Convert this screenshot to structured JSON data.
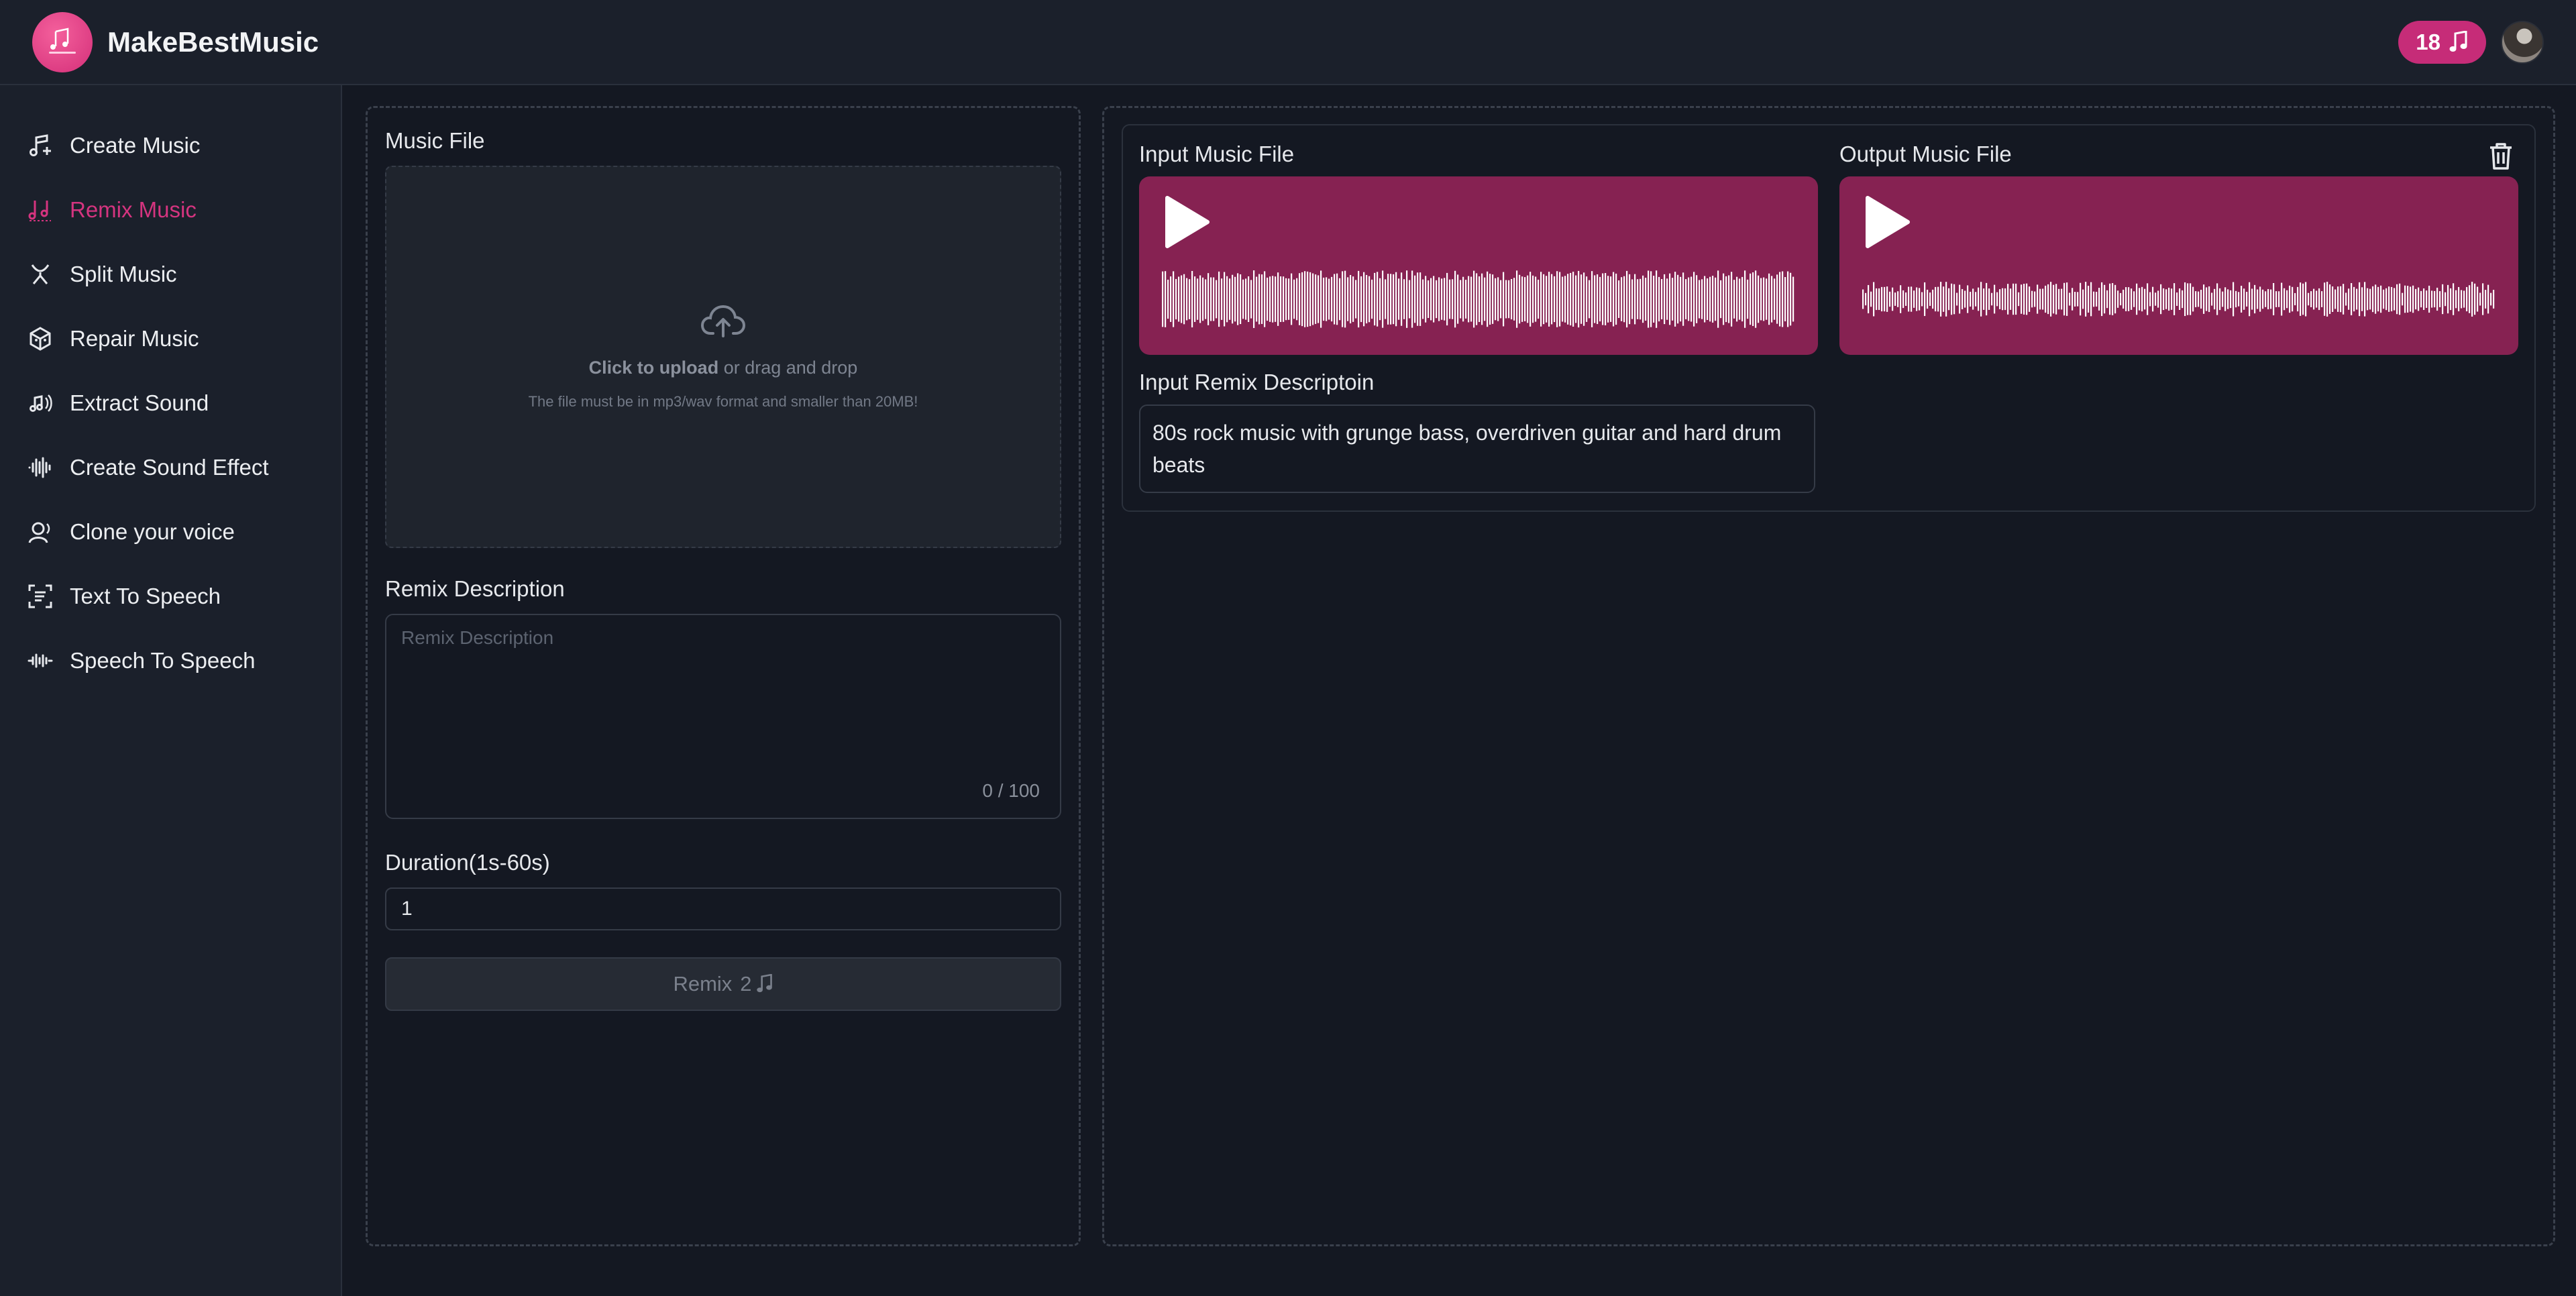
{
  "app": {
    "brand_name": "MakeBestMusic",
    "credits": "18"
  },
  "colors": {
    "accent": "#d4347f",
    "player_bg": "#862252",
    "badge_bg": "#c62c78"
  },
  "sidebar": {
    "items": [
      {
        "label": "Create Music",
        "icon": "music-note-plus-icon"
      },
      {
        "label": "Remix Music",
        "icon": "music-notes-icon",
        "active": true
      },
      {
        "label": "Split Music",
        "icon": "split-icon"
      },
      {
        "label": "Repair Music",
        "icon": "cube-icon"
      },
      {
        "label": "Extract Sound",
        "icon": "note-sound-icon"
      },
      {
        "label": "Create Sound Effect",
        "icon": "waveform-icon"
      },
      {
        "label": "Clone your voice",
        "icon": "voice-clone-icon"
      },
      {
        "label": "Text To Speech",
        "icon": "text-scan-icon"
      },
      {
        "label": "Speech To Speech",
        "icon": "speech-wave-icon"
      }
    ]
  },
  "form": {
    "music_file_label": "Music File",
    "upload_click": "Click to upload",
    "upload_drag": " or drag and drop",
    "upload_hint": "The file must be in mp3/wav format and smaller than 20MB!",
    "remix_description_label": "Remix Description",
    "remix_description_placeholder": "Remix Description",
    "remix_description_counter": "0 / 100",
    "duration_label": "Duration(1s-60s)",
    "duration_value": "1",
    "remix_button_label": "Remix",
    "remix_button_cost": "2"
  },
  "result": {
    "input_file_label": "Input Music File",
    "output_file_label": "Output Music File",
    "input_description_label": "Input Remix Descriptoin",
    "input_description_text": "80s rock music with grunge bass, overdriven guitar and hard drum beats"
  }
}
